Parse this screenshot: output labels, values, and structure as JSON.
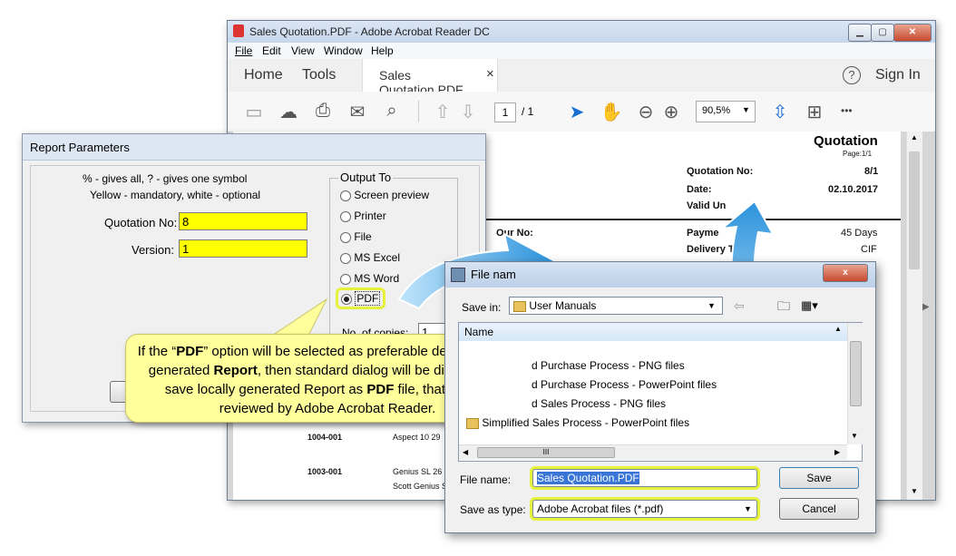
{
  "acrobat": {
    "title": "Sales Quotation.PDF - Adobe Acrobat Reader DC",
    "menu": [
      "File",
      "Edit",
      "View",
      "Window",
      "Help"
    ],
    "tabs": {
      "home": "Home",
      "tools": "Tools",
      "doc": "Sales Quotation.PDF",
      "close": "×"
    },
    "help_icon": "?",
    "signin": "Sign In",
    "page_current": "1",
    "page_total": "/ 1",
    "zoom": "90,5%",
    "more": "•••"
  },
  "document": {
    "heading": "Quotation",
    "page_label": "Page:1/1",
    "fields": [
      {
        "label": "Quotation No:",
        "value": "8/1"
      },
      {
        "label": "Date:",
        "value": "02.10.2017"
      },
      {
        "label": "Valid Un",
        "value": ""
      }
    ],
    "our_no": "Our No:",
    "payment_label": "Payme",
    "payment_value": "45 Days",
    "delivery_label": "Delivery Te",
    "delivery_value": "CIF",
    "rows": [
      {
        "code": "1004-001",
        "desc": "Aspect 10 29"
      },
      {
        "code": "1003-001",
        "desc": "Genius SL 26"
      },
      {
        "code": "",
        "desc": "Scott Genius S"
      }
    ]
  },
  "report_params": {
    "title": "Report Parameters",
    "hint1": "% - gives all, ? - gives one symbol",
    "hint2": "Yellow - mandatory, white - optional",
    "quotation_label": "Quotation No:",
    "quotation_value": "8",
    "version_label": "Version:",
    "version_value": "1",
    "output_to": "Output To",
    "options": [
      "Screen preview",
      "Printer",
      "File",
      "MS Excel",
      "MS Word",
      "PDF"
    ],
    "selected": "PDF",
    "copies_label": "No. of copies:",
    "copies_value": "1"
  },
  "callout": {
    "part1": "If the “",
    "pdf1": "PDF",
    "part2": "” option will be selected as preferable destination for generated ",
    "report": "Report",
    "part3": ", then standard dialog will be displayed to save locally generated Report as ",
    "pdf2": "PDF",
    "part4": " file, that can be reviewed by Adobe Acrobat Reader."
  },
  "file_dialog": {
    "title": "File nam",
    "close": "x",
    "save_in_label": "Save in:",
    "save_in_value": "User Manuals",
    "column_header": "Name",
    "items": [
      "d Purchase Process - PNG files",
      "d Purchase Process - PowerPoint files",
      "d Sales Process - PNG files",
      "Simplified Sales Process - PowerPoint files"
    ],
    "hscroll_grip": "III",
    "file_name_label": "File name:",
    "file_name_value": "Sales Quotation.PDF",
    "save_type_label": "Save as type:",
    "save_type_value": "Adobe Acrobat files (*.pdf)",
    "save_button": "Save",
    "cancel_button": "Cancel"
  },
  "colors": {
    "highlight": "#e6f23a",
    "mandatory": "#ffff00",
    "callout": "#ffff9c",
    "arrow": "#3aa0e0"
  }
}
